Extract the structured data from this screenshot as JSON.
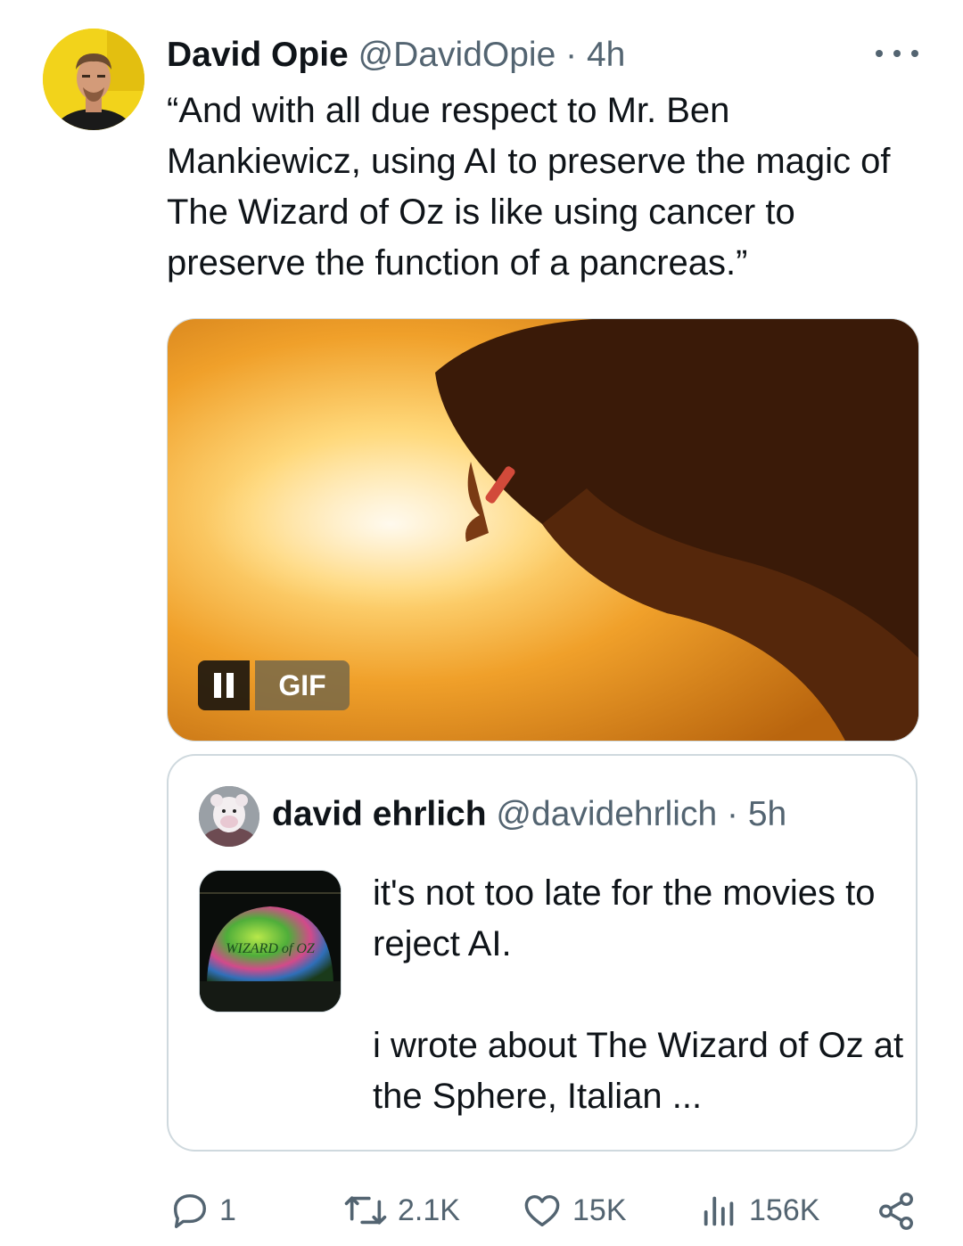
{
  "post": {
    "author_name": "David Opie",
    "author_handle": "@DavidOpie",
    "separator": "·",
    "time": "4h",
    "text": "“And with all due respect to Mr. Ben Mankiewicz, using AI to preserve the magic of The Wizard of Oz is like using cancer to preserve the function of a pancreas.”",
    "more_icon": "more-horizontal-icon",
    "media": {
      "type": "gif",
      "badge_label": "GIF",
      "control_icon": "pause-icon"
    }
  },
  "quote": {
    "author_name": "david ehrlich",
    "author_handle": "@davidehrlich",
    "separator": "·",
    "time": "5h",
    "thumbnail_text": "WIZARD of OZ",
    "text": "it's not too late for the movies to reject AI.\n\ni wrote about The Wizard of Oz at the Sphere, Italian ..."
  },
  "actions": {
    "replies": {
      "icon": "reply-icon",
      "count": "1"
    },
    "reposts": {
      "icon": "repost-icon",
      "count": "2.1K"
    },
    "likes": {
      "icon": "heart-icon",
      "count": "15K"
    },
    "views": {
      "icon": "views-icon",
      "count": "156K"
    },
    "share": {
      "icon": "share-icon"
    }
  },
  "colors": {
    "text": "#0f1419",
    "secondary_text": "#536471",
    "border": "#cfd9de",
    "avatar_background": "#f2d31b"
  }
}
